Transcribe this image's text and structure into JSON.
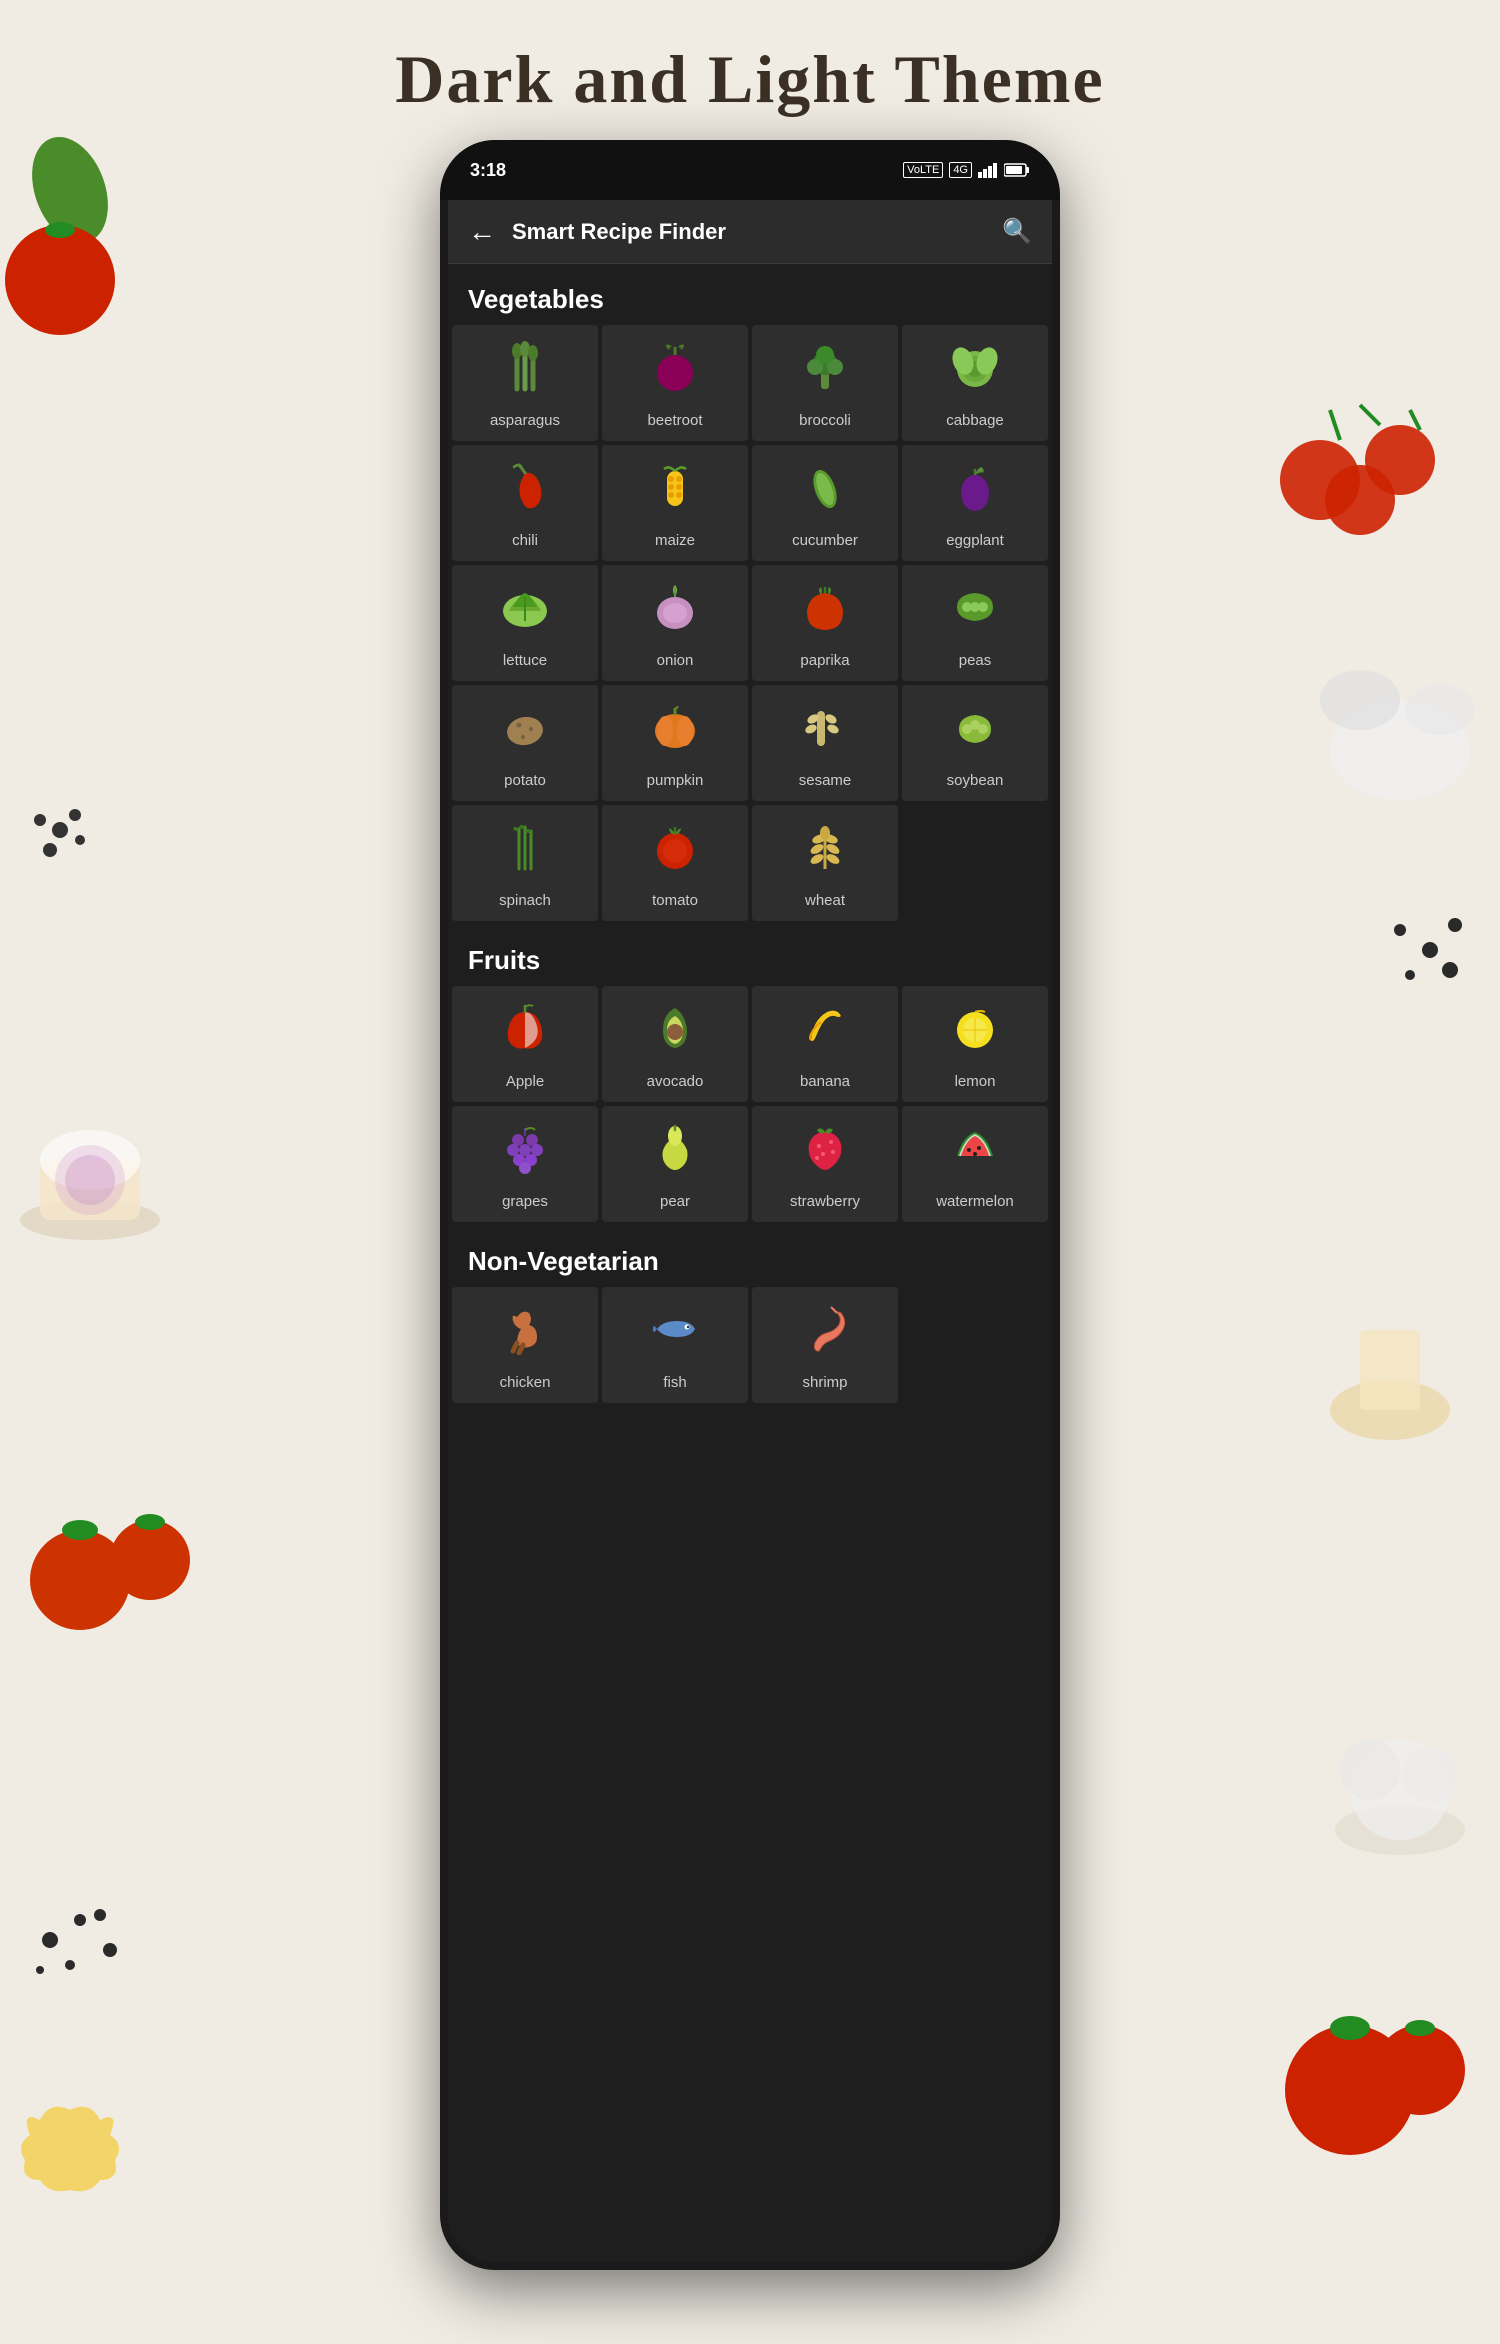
{
  "page": {
    "title": "Dark and Light Theme"
  },
  "phone": {
    "status_time": "3:18",
    "status_icons_right": [
      "wifi",
      "volte",
      "4g",
      "signal",
      "battery"
    ]
  },
  "app": {
    "title": "Smart Recipe Finder",
    "back_label": "←",
    "search_label": "🔍"
  },
  "sections": [
    {
      "id": "vegetables",
      "label": "Vegetables",
      "items": [
        {
          "id": "asparagus",
          "label": "asparagus",
          "emoji": "🥦"
        },
        {
          "id": "beetroot",
          "label": "beetroot",
          "emoji": "🫚"
        },
        {
          "id": "broccoli",
          "label": "broccoli",
          "emoji": "🥦"
        },
        {
          "id": "cabbage",
          "label": "cabbage",
          "emoji": "🥬"
        },
        {
          "id": "chili",
          "label": "chili",
          "emoji": "🌶️"
        },
        {
          "id": "maize",
          "label": "maize",
          "emoji": "🌽"
        },
        {
          "id": "cucumber",
          "label": "cucumber",
          "emoji": "🥒"
        },
        {
          "id": "eggplant",
          "label": "eggplant",
          "emoji": "🍆"
        },
        {
          "id": "lettuce",
          "label": "lettuce",
          "emoji": "🥬"
        },
        {
          "id": "onion",
          "label": "onion",
          "emoji": "🧅"
        },
        {
          "id": "paprika",
          "label": "paprika",
          "emoji": "🫑"
        },
        {
          "id": "peas",
          "label": "peas",
          "emoji": "🫛"
        },
        {
          "id": "potato",
          "label": "potato",
          "emoji": "🥔"
        },
        {
          "id": "pumpkin",
          "label": "pumpkin",
          "emoji": "🎃"
        },
        {
          "id": "sesame",
          "label": "sesame",
          "emoji": "🌿"
        },
        {
          "id": "soybean",
          "label": "soybean",
          "emoji": "🫘"
        },
        {
          "id": "spinach",
          "label": "spinach",
          "emoji": "🌱"
        },
        {
          "id": "tomato",
          "label": "tomato",
          "emoji": "🍅"
        },
        {
          "id": "wheat",
          "label": "wheat",
          "emoji": "🌾"
        }
      ]
    },
    {
      "id": "fruits",
      "label": "Fruits",
      "items": [
        {
          "id": "apple",
          "label": "Apple",
          "emoji": "🍎"
        },
        {
          "id": "avocado",
          "label": "avocado",
          "emoji": "🥑"
        },
        {
          "id": "banana",
          "label": "banana",
          "emoji": "🍌"
        },
        {
          "id": "lemon",
          "label": "lemon",
          "emoji": "🍋"
        },
        {
          "id": "grapes",
          "label": "grapes",
          "emoji": "🍇"
        },
        {
          "id": "pear",
          "label": "pear",
          "emoji": "🍐"
        },
        {
          "id": "strawberry",
          "label": "strawberry",
          "emoji": "🍓"
        },
        {
          "id": "watermelon",
          "label": "watermelon",
          "emoji": "🍉"
        }
      ]
    },
    {
      "id": "non-vegetarian",
      "label": "Non-Vegetarian",
      "items": [
        {
          "id": "chicken",
          "label": "chicken",
          "emoji": "🍗"
        },
        {
          "id": "fish",
          "label": "fish",
          "emoji": "🐟"
        },
        {
          "id": "shrimp",
          "label": "shrimp",
          "emoji": "🦐"
        }
      ]
    }
  ],
  "colors": {
    "background": "#f0ece4",
    "phone_body": "#1a1a1a",
    "screen_bg": "#1e1e1e",
    "cell_bg": "#2e2e2e",
    "text_white": "#ffffff",
    "text_label": "#cccccc"
  }
}
